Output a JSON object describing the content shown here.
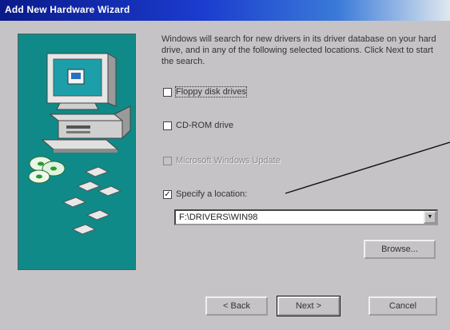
{
  "window": {
    "title": "Add New Hardware Wizard",
    "colors": {
      "title_gradient_start": "#0a1a8a",
      "title_gradient_end": "#dfe8ef",
      "dialog_face": "#c6c3c6",
      "side_panel": "#0f8a88"
    }
  },
  "intro_text": "Windows will search for new drivers in its driver database on your hard drive, and in any of the following selected locations. Click Next to start the search.",
  "options": [
    {
      "label": "Floppy disk drives",
      "checked": false,
      "enabled": true,
      "focused": true
    },
    {
      "label": "CD-ROM drive",
      "checked": false,
      "enabled": true,
      "focused": false
    },
    {
      "label": "Microsoft Windows Update",
      "checked": false,
      "enabled": false,
      "focused": false
    },
    {
      "label": "Specify a location:",
      "checked": true,
      "enabled": true,
      "focused": false
    }
  ],
  "location_path": "F:\\DRIVERS\\WIN98",
  "buttons": {
    "browse": "Browse...",
    "back": "< Back",
    "next": "Next >",
    "cancel": "Cancel"
  }
}
